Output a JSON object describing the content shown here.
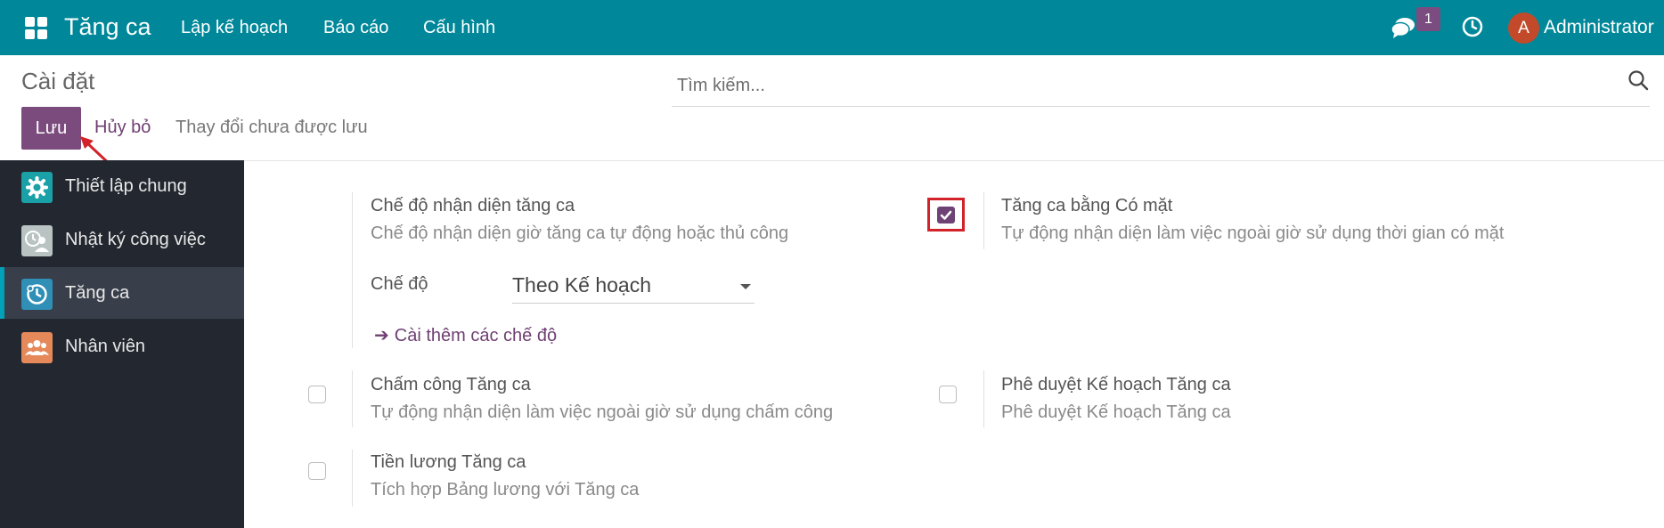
{
  "app": {
    "name": "Tăng ca",
    "menu": [
      "Lập kế hoạch",
      "Báo cáo",
      "Cấu hình"
    ],
    "notifications_count": "1",
    "user": {
      "initial": "A",
      "name": "Administrator"
    }
  },
  "colors": {
    "topbar": "#00889a",
    "primary": "#7b4b7d",
    "sidebar": "#232830",
    "highlight": "#d2232a"
  },
  "page": {
    "title": "Cài đặt",
    "search_placeholder": "Tìm kiếm...",
    "save_label": "Lưu",
    "cancel_label": "Hủy bỏ",
    "unsaved_text": "Thay đổi chưa được lưu"
  },
  "sidebar": {
    "items": [
      {
        "label": "Thiết lập chung",
        "icon": "gear-icon"
      },
      {
        "label": "Nhật ký công việc",
        "icon": "worklog-icon"
      },
      {
        "label": "Tăng ca",
        "icon": "overtime-icon",
        "active": true
      },
      {
        "label": "Nhân viên",
        "icon": "employees-icon"
      }
    ]
  },
  "settings": {
    "detection": {
      "title": "Chế độ nhận diện tăng ca",
      "desc": "Chế độ nhận diện giờ tăng ca tự động hoặc thủ công",
      "mode_label": "Chế độ",
      "mode_value": "Theo Kế hoạch",
      "more_link": "Cài thêm các chế độ"
    },
    "attendance": {
      "title": "Tăng ca bằng Có mặt",
      "desc": "Tự động nhận diện làm việc ngoài giờ sử dụng thời gian có mặt",
      "checked": true
    },
    "timesheet": {
      "title": "Chấm công Tăng ca",
      "desc": "Tự động nhận diện làm việc ngoài giờ sử dụng chấm công",
      "checked": false
    },
    "approval": {
      "title": "Phê duyệt Kế hoạch Tăng ca",
      "desc": "Phê duyệt Kế hoạch Tăng ca",
      "checked": false
    },
    "payroll": {
      "title": "Tiền lương Tăng ca",
      "desc": "Tích hợp Bảng lương với Tăng ca",
      "checked": false
    }
  }
}
